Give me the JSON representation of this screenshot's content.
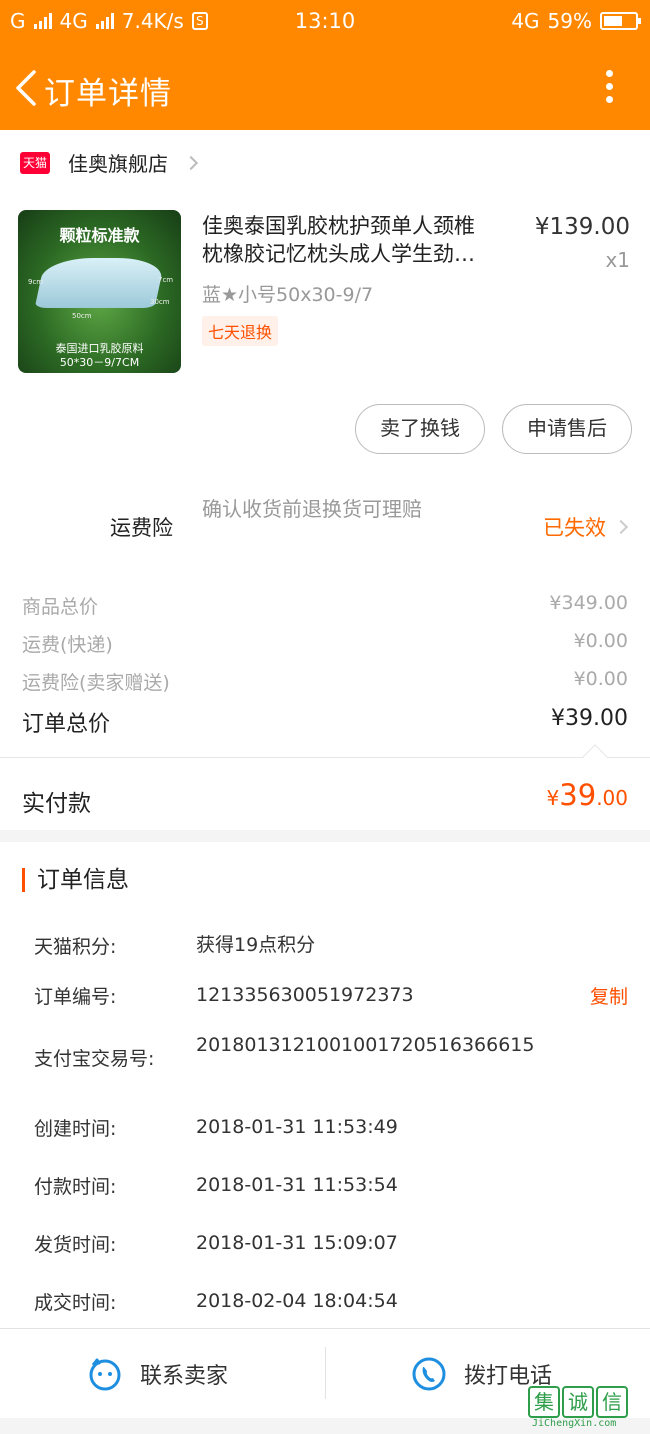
{
  "status_bar": {
    "carrier": "G",
    "network": "4G",
    "speed": "7.4K/s",
    "s_icon_text": "S",
    "time": "13:10",
    "network_right": "4G",
    "battery_text": "59%",
    "battery_level": 0.59
  },
  "header": {
    "title": "订单详情"
  },
  "shop": {
    "badge": "天猫",
    "name": "佳奥旗舰店"
  },
  "product": {
    "image_title": "颗粒标准款",
    "image_caption_line1": "泰国进口乳胶原料",
    "image_caption_line2": "50*30－9/7CM",
    "image_dims": [
      "9cm",
      "7cm",
      "30cm",
      "50cm"
    ],
    "name_line1": "佳奥泰国乳胶枕护颈单人颈椎",
    "name_line2": "枕橡胶记忆枕头成人学生劲…",
    "price": "¥139.00",
    "quantity": "x1",
    "spec": "蓝★小号50x30-9/7",
    "tag": "七天退换"
  },
  "actions": {
    "sell": "卖了换钱",
    "after_sale": "申请售后"
  },
  "insurance": {
    "label": "运费险",
    "desc": "确认收货前退换货可理赔",
    "status": "已失效"
  },
  "summary": {
    "rows": [
      {
        "label": "商品总价",
        "value": "¥349.00"
      },
      {
        "label": "运费(快递)",
        "value": "¥0.00"
      },
      {
        "label": "运费险(卖家赠送)",
        "value": "¥0.00"
      }
    ],
    "total_label": "订单总价",
    "total_value": "¥39.00",
    "paid_label": "实付款",
    "paid_currency": "¥",
    "paid_int": "39",
    "paid_dec": ".00"
  },
  "order_info": {
    "heading": "订单信息",
    "rows": [
      {
        "key": "天猫积分:",
        "value": "获得19点积分"
      },
      {
        "key": "订单编号:",
        "value": "121335630051972373",
        "action": "复制"
      },
      {
        "key": "支付宝交易号:",
        "value": "2018013121001001720516366615"
      },
      {
        "key": "创建时间:",
        "value": "2018-01-31 11:53:49"
      },
      {
        "key": "付款时间:",
        "value": "2018-01-31 11:53:54"
      },
      {
        "key": "发货时间:",
        "value": "2018-01-31 15:09:07"
      },
      {
        "key": "成交时间:",
        "value": "2018-02-04 18:04:54"
      }
    ]
  },
  "bottom_bar": {
    "contact_seller": "联系卖家",
    "call": "拨打电话"
  },
  "watermark": {
    "chars": [
      "集",
      "诚",
      "信"
    ],
    "url": "JiChengXin.com"
  },
  "colors": {
    "brand": "#ff8800",
    "accent": "#ff5000",
    "icon_blue": "#1e8fe0"
  }
}
